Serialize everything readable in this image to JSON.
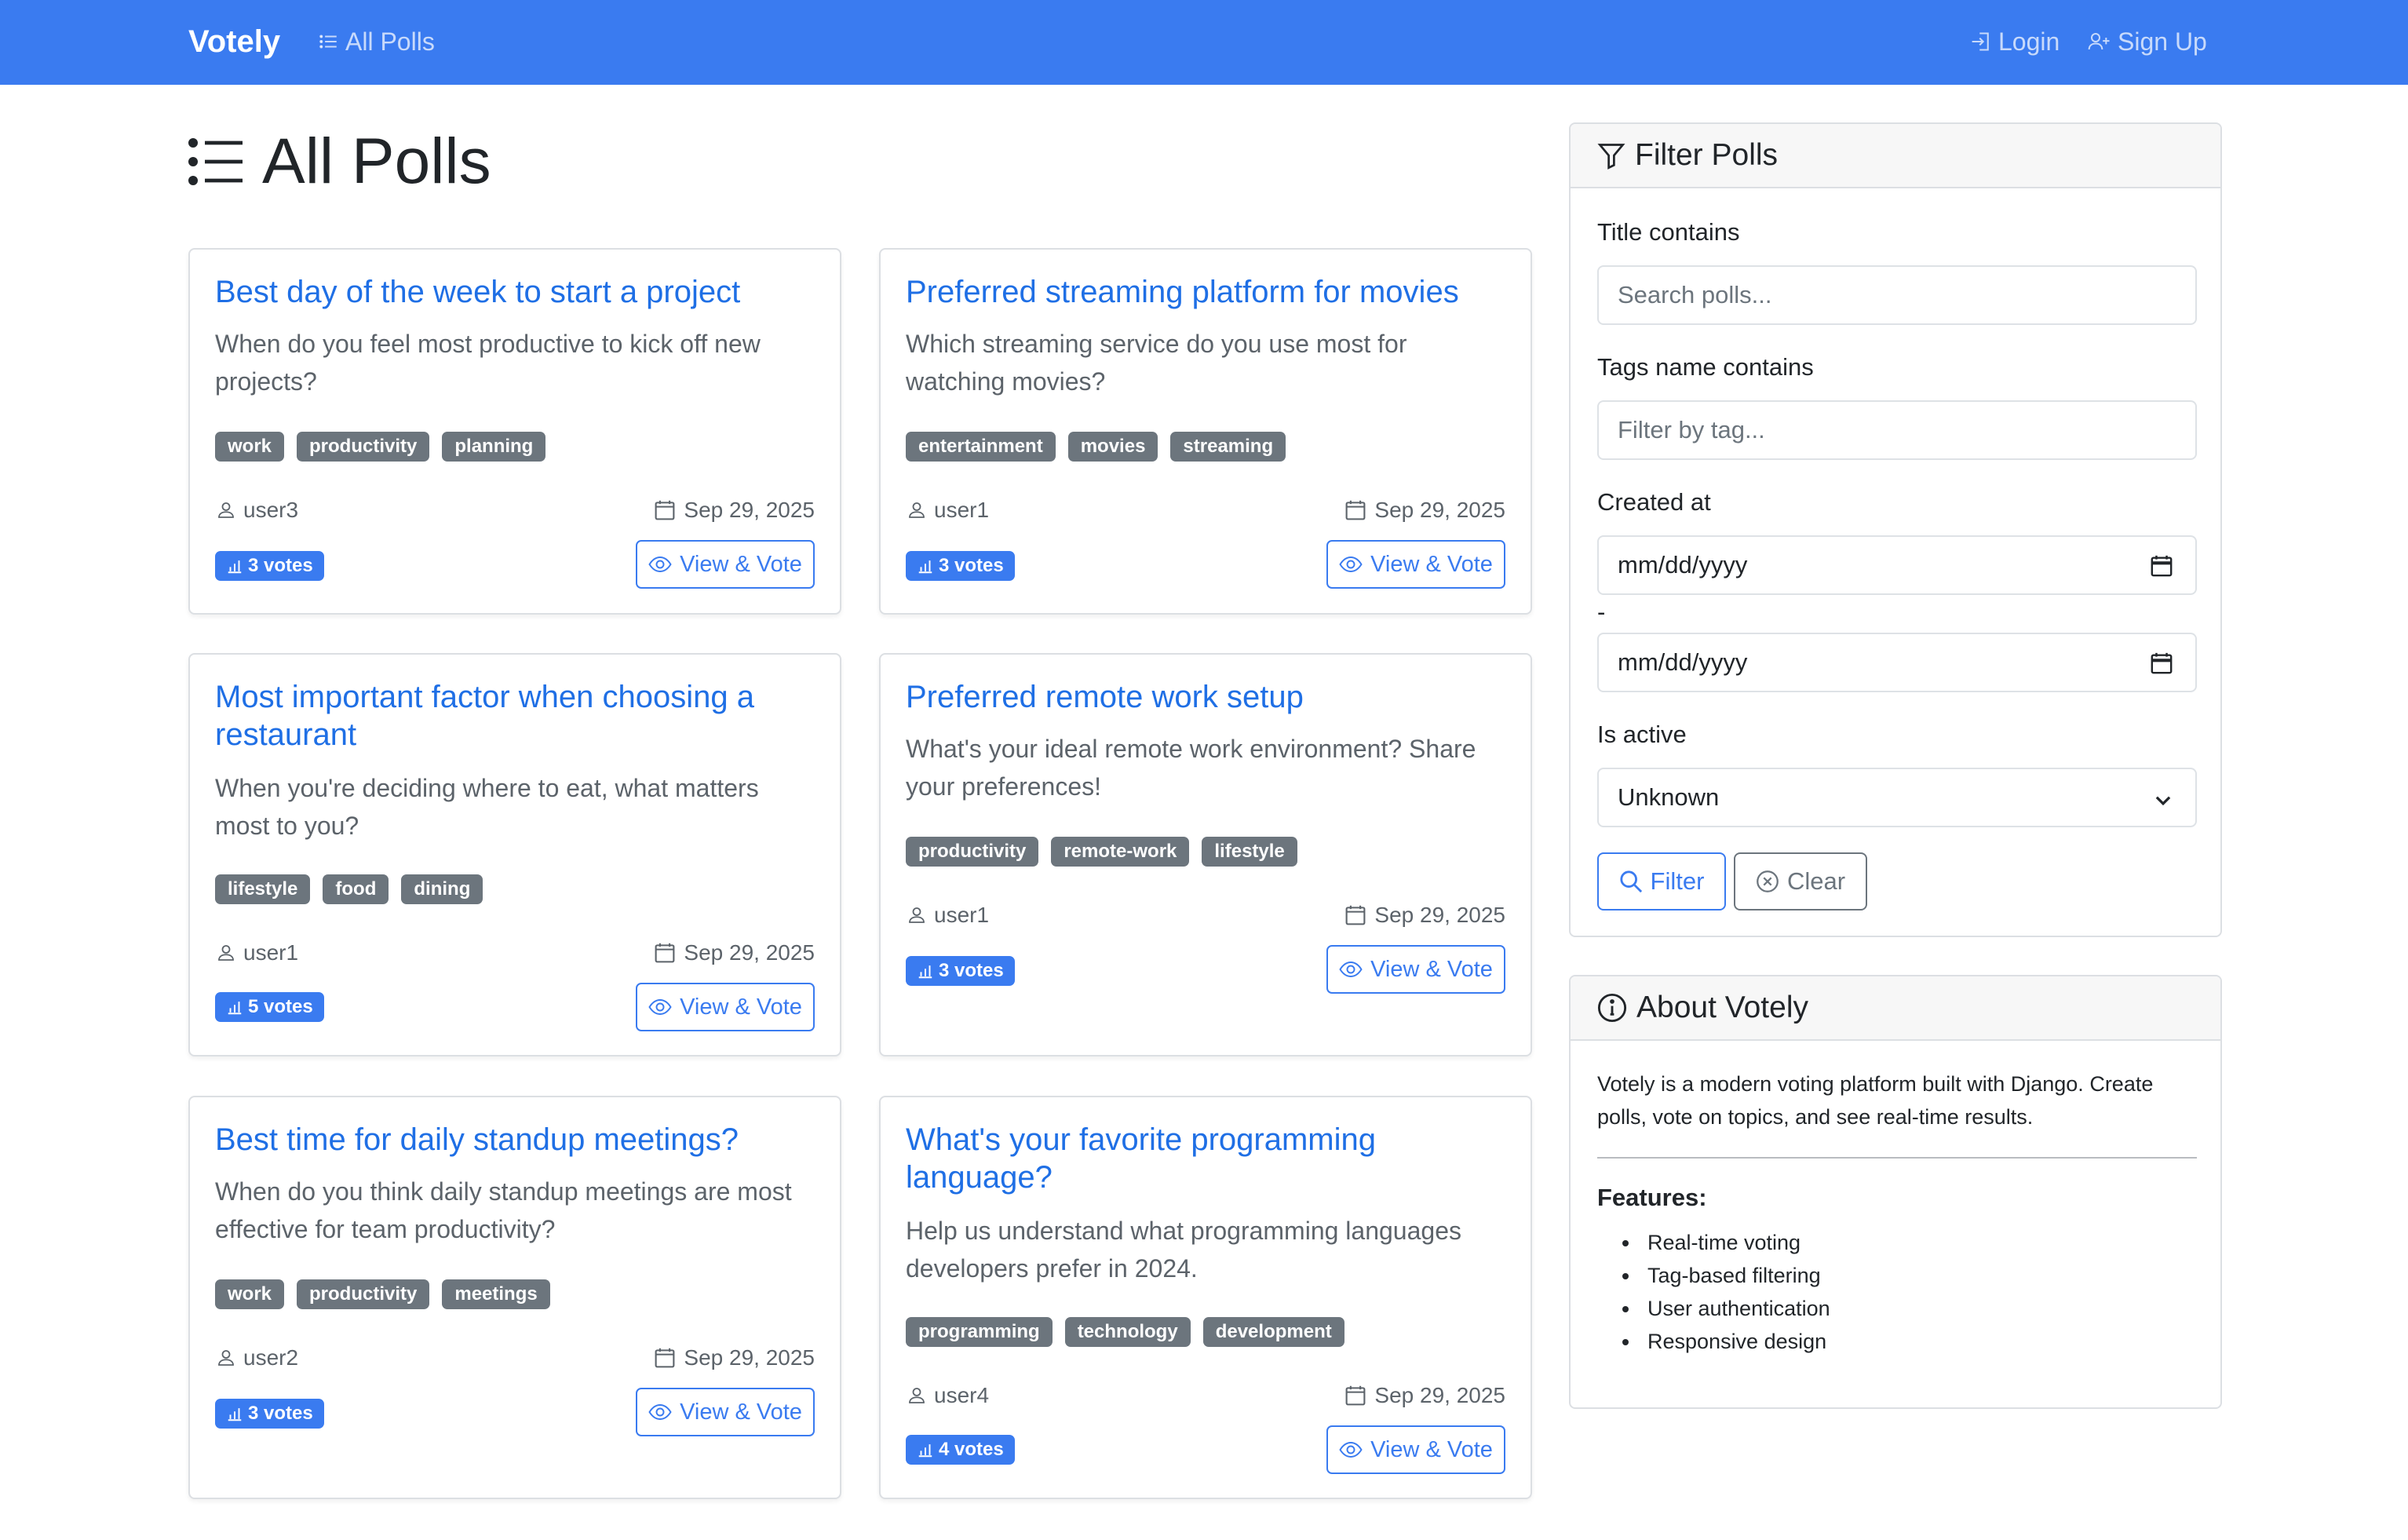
{
  "nav": {
    "brand": "Votely",
    "all_polls": "All Polls",
    "login": "Login",
    "signup": "Sign Up"
  },
  "page_title": "All Polls",
  "polls": [
    {
      "title": "Best day of the week to start a project",
      "description": "When do you feel most productive to kick off new projects?",
      "tags": [
        "work",
        "productivity",
        "planning"
      ],
      "author": "user3",
      "date": "Sep 29, 2025",
      "votes": "3 votes",
      "action": "View & Vote"
    },
    {
      "title": "Preferred streaming platform for movies",
      "description": "Which streaming service do you use most for watching movies?",
      "tags": [
        "entertainment",
        "movies",
        "streaming"
      ],
      "author": "user1",
      "date": "Sep 29, 2025",
      "votes": "3 votes",
      "action": "View & Vote"
    },
    {
      "title": "Most important factor when choosing a restaurant",
      "description": "When you're deciding where to eat, what matters most to you?",
      "tags": [
        "lifestyle",
        "food",
        "dining"
      ],
      "author": "user1",
      "date": "Sep 29, 2025",
      "votes": "5 votes",
      "action": "View & Vote"
    },
    {
      "title": "Preferred remote work setup",
      "description": "What's your ideal remote work environment? Share your preferences!",
      "tags": [
        "productivity",
        "remote-work",
        "lifestyle"
      ],
      "author": "user1",
      "date": "Sep 29, 2025",
      "votes": "3 votes",
      "action": "View & Vote"
    },
    {
      "title": "Best time for daily standup meetings?",
      "description": "When do you think daily standup meetings are most effective for team productivity?",
      "tags": [
        "work",
        "productivity",
        "meetings"
      ],
      "author": "user2",
      "date": "Sep 29, 2025",
      "votes": "3 votes",
      "action": "View & Vote"
    },
    {
      "title": "What's your favorite programming language?",
      "description": "Help us understand what programming languages developers prefer in 2024.",
      "tags": [
        "programming",
        "technology",
        "development"
      ],
      "author": "user4",
      "date": "Sep 29, 2025",
      "votes": "4 votes",
      "action": "View & Vote"
    }
  ],
  "filter": {
    "header": "Filter Polls",
    "title_label": "Title contains",
    "title_placeholder": "Search polls...",
    "tags_label": "Tags name contains",
    "tags_placeholder": "Filter by tag...",
    "created_label": "Created at",
    "date_from": "mm/dd/yyyy",
    "range_separator": "-",
    "date_to": "mm/dd/yyyy",
    "active_label": "Is active",
    "active_value": "Unknown",
    "filter_button": "Filter",
    "clear_button": "Clear"
  },
  "about": {
    "header": "About Votely",
    "text": "Votely is a modern voting platform built with Django. Create polls, vote on topics, and see real-time results.",
    "features_title": "Features:",
    "features": [
      "Real-time voting",
      "Tag-based filtering",
      "User authentication",
      "Responsive design"
    ]
  },
  "colors": {
    "primary": "#3a7bf0",
    "link": "#1f6fe5",
    "tag": "#6c757d",
    "border": "#dcdfe3"
  }
}
